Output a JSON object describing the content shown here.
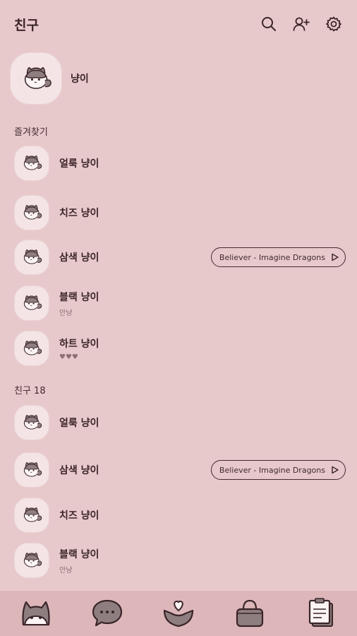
{
  "header": {
    "title": "친구"
  },
  "me": {
    "name": "냥이"
  },
  "favorites": {
    "label": "즐겨찾기",
    "items": [
      {
        "name": "얼룩 냥이",
        "status": "",
        "music": ""
      },
      {
        "name": "치즈 냥이",
        "status": "",
        "music": ""
      },
      {
        "name": "삼색 냥이",
        "status": "",
        "music": "Believer - Imagine Dragons"
      },
      {
        "name": "블랙 냥이",
        "status": "안냥",
        "music": ""
      },
      {
        "name": "하트 냥이",
        "status": "♥♥♥",
        "music": ""
      }
    ]
  },
  "friends": {
    "label": "친구 18",
    "items": [
      {
        "name": "얼룩 냥이",
        "status": "",
        "music": ""
      },
      {
        "name": "삼색 냥이",
        "status": "",
        "music": "Believer - Imagine Dragons"
      },
      {
        "name": "치즈 냥이",
        "status": "",
        "music": ""
      },
      {
        "name": "블랙 냥이",
        "status": "안냥",
        "music": ""
      }
    ]
  },
  "icons": {
    "header": [
      "search-icon",
      "add-friend-icon",
      "settings-icon"
    ],
    "nav": [
      "cat-friends-icon",
      "chat-bubble-icon",
      "heart-view-icon",
      "shopping-bag-icon",
      "more-notes-icon"
    ]
  },
  "colors": {
    "background": "#e8c9cb",
    "nav_background": "#dcb6b9",
    "accent": "#3f2a2e"
  }
}
